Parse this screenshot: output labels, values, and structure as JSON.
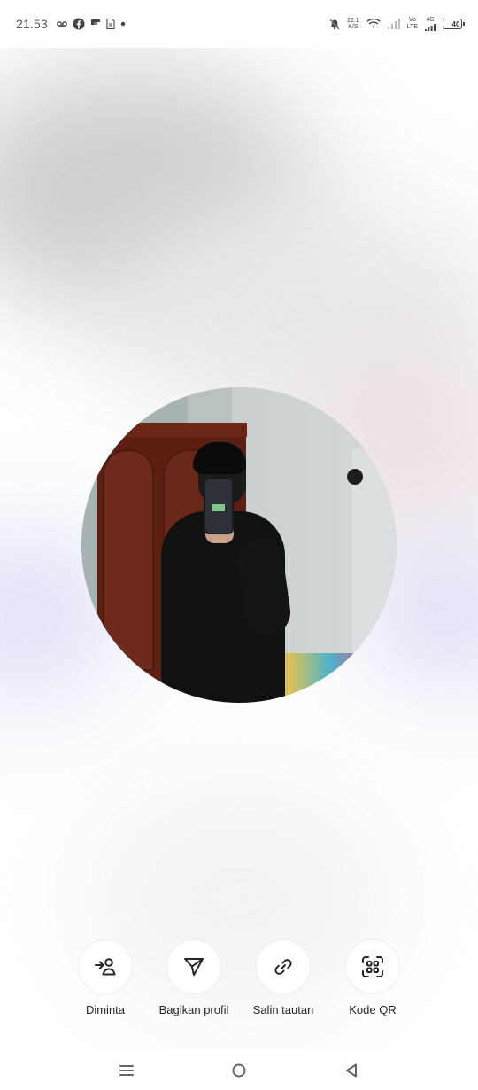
{
  "status_bar": {
    "time": "21.53",
    "net_speed_value": "22.1",
    "net_speed_unit": "K/S",
    "volte_top": "Vo",
    "volte_bottom": "LTE",
    "network": "4G",
    "battery": "40"
  },
  "profile": {
    "photo": "profile-picture"
  },
  "actions": [
    {
      "label": "Diminta",
      "icon": "user-requested-icon"
    },
    {
      "label": "Bagikan profil",
      "icon": "send-icon"
    },
    {
      "label": "Salin tautan",
      "icon": "link-icon"
    },
    {
      "label": "Kode QR",
      "icon": "qr-scan-icon"
    }
  ],
  "colors": {
    "icon": "#262626",
    "label": "#262626",
    "battery_fill": "#8dd36f"
  }
}
